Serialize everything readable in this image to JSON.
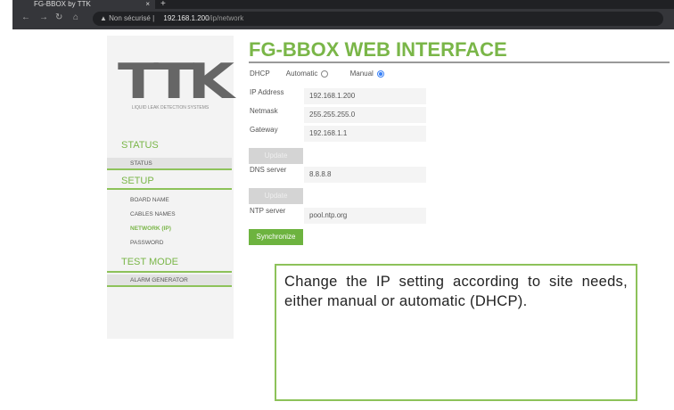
{
  "browser": {
    "tab_title": "FG-BBOX by TTK",
    "security": "Non sécurisé",
    "url_host": "192.168.1.200",
    "url_path": "/ip/network"
  },
  "sidebar": {
    "logo": "TTK",
    "tagline": "LIQUID LEAK DETECTION SYSTEMS",
    "sections": [
      {
        "title": "STATUS",
        "items": [
          "STATUS"
        ]
      },
      {
        "title": "SETUP",
        "items": [
          "BOARD NAME",
          "CABLES NAMES",
          "NETWORK (IP)",
          "PASSWORD"
        ]
      },
      {
        "title": "TEST MODE",
        "items": [
          "ALARM GENERATOR"
        ]
      }
    ],
    "active_color": "#7ab648"
  },
  "main": {
    "title": "FG-BBOX WEB INTERFACE",
    "dhcp_label": "DHCP",
    "automatic": "Automatic",
    "manual": "Manual",
    "selected": "Manual",
    "ip_label": "IP Address",
    "ip": "192.168.1.200",
    "netmask_label": "Netmask",
    "netmask": "255.255.255.0",
    "gateway_label": "Gateway",
    "gateway": "192.168.1.1",
    "update": "Update",
    "dns_label": "DNS server",
    "dns": "8.8.8.8",
    "ntp_label": "NTP server",
    "ntp": "pool.ntp.org",
    "sync": "Synchronize"
  },
  "callout": "Change the IP setting according to site needs, either manual or automatic (DHCP)."
}
